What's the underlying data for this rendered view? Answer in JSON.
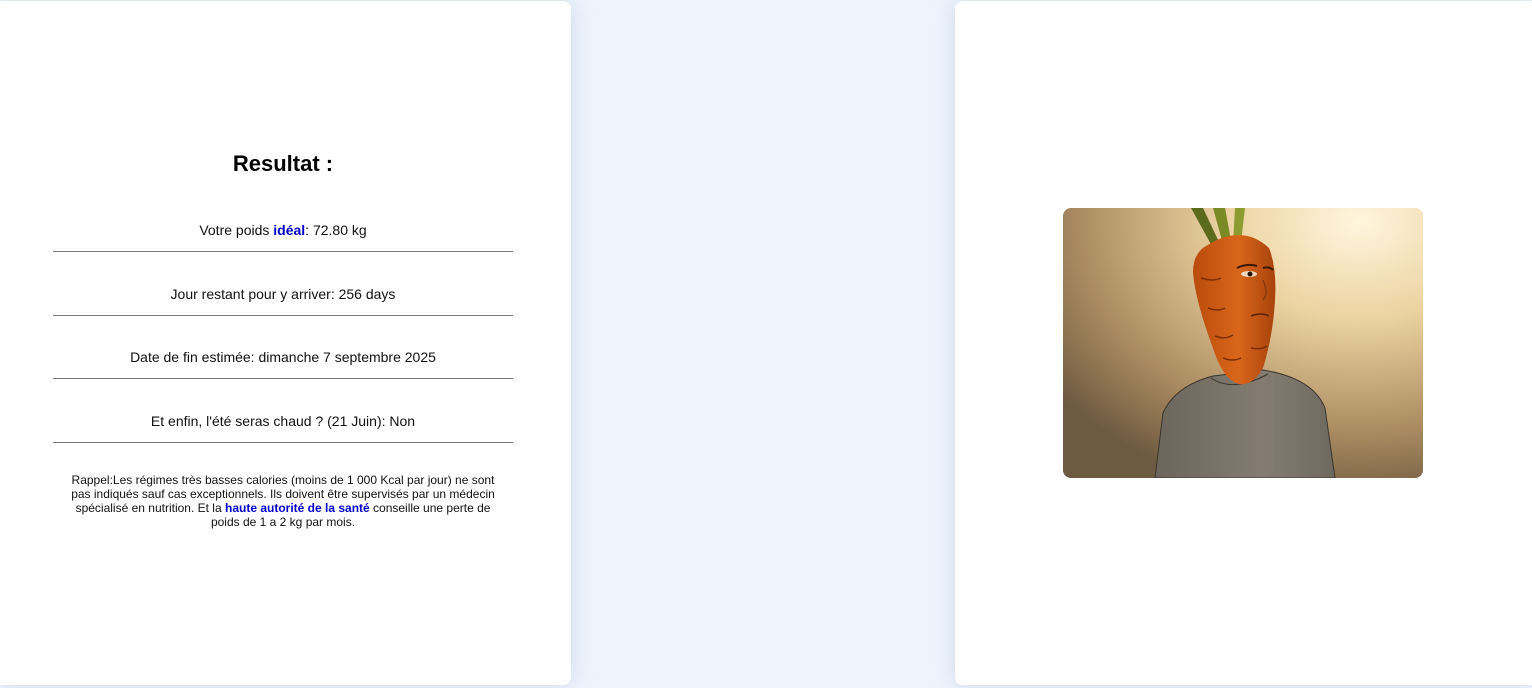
{
  "results": {
    "title": "Resultat :",
    "rows": [
      {
        "prefix": "Votre poids ",
        "highlight": "idéal",
        "suffix": ": 72.80 kg"
      },
      {
        "text": "Jour restant pour y arriver: 256 days"
      },
      {
        "text": "Date de fin estimée: dimanche 7 septembre 2025"
      },
      {
        "text": "Et enfin, l'été seras chaud ? (21 Juin): Non"
      }
    ],
    "reminder": {
      "before": "Rappel:Les régimes très basses calories (moins de 1 000 Kcal par jour) ne sont pas indiqués sauf cas exceptionnels. Ils doivent être supervisés par un médecin spécialisé en nutrition. Et la ",
      "link": "haute autorité de la santé",
      "after": " conseille une perte de poids de 1 a 2 kg par mois."
    }
  },
  "image": {
    "subject": "carrot-headed character illustration",
    "colors": {
      "carrot": "#cf5c14",
      "sweater": "#7b7468",
      "background": "#e6c995"
    }
  }
}
